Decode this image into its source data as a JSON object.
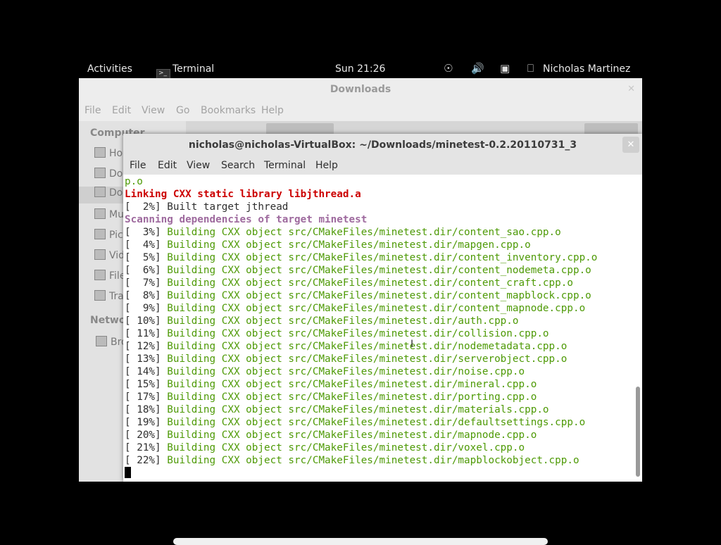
{
  "top_panel": {
    "activities": "Activities",
    "app_name": "Terminal",
    "clock": "Sun 21:26",
    "user": "Nicholas Martinez"
  },
  "file_manager": {
    "title": "Downloads",
    "menu": [
      "File",
      "Edit",
      "View",
      "Go",
      "Bookmarks",
      "Help"
    ],
    "sidebar_headers": [
      "Computer",
      "Netwo"
    ],
    "sidebar_items": [
      "Ho",
      "Do",
      "Do",
      "Mu",
      "Pic",
      "Vid",
      "File",
      "Tra",
      "Bro"
    ]
  },
  "terminal": {
    "title": "nicholas@nicholas-VirtualBox: ~/Downloads/minetest-0.2.20110731_3",
    "menu": [
      "File",
      "Edit",
      "View",
      "Search",
      "Terminal",
      "Help"
    ],
    "lines": [
      {
        "prefix": "",
        "text": "p.o",
        "style": "g"
      },
      {
        "prefix": "",
        "text": "Linking CXX static library libjthread.a",
        "style": "r"
      },
      {
        "prefix": "[  2%] ",
        "text": "Built target jthread",
        "style": ""
      },
      {
        "prefix": "",
        "text": "Scanning dependencies of target minetest",
        "style": "m"
      },
      {
        "prefix": "[  3%] ",
        "text": "Building CXX object src/CMakeFiles/minetest.dir/content_sao.cpp.o",
        "style": "g"
      },
      {
        "prefix": "[  4%] ",
        "text": "Building CXX object src/CMakeFiles/minetest.dir/mapgen.cpp.o",
        "style": "g"
      },
      {
        "prefix": "[  5%] ",
        "text": "Building CXX object src/CMakeFiles/minetest.dir/content_inventory.cpp.o",
        "style": "g"
      },
      {
        "prefix": "[  6%] ",
        "text": "Building CXX object src/CMakeFiles/minetest.dir/content_nodemeta.cpp.o",
        "style": "g"
      },
      {
        "prefix": "[  7%] ",
        "text": "Building CXX object src/CMakeFiles/minetest.dir/content_craft.cpp.o",
        "style": "g"
      },
      {
        "prefix": "[  8%] ",
        "text": "Building CXX object src/CMakeFiles/minetest.dir/content_mapblock.cpp.o",
        "style": "g"
      },
      {
        "prefix": "[  9%] ",
        "text": "Building CXX object src/CMakeFiles/minetest.dir/content_mapnode.cpp.o",
        "style": "g"
      },
      {
        "prefix": "[ 10%] ",
        "text": "Building CXX object src/CMakeFiles/minetest.dir/auth.cpp.o",
        "style": "g"
      },
      {
        "prefix": "[ 11%] ",
        "text": "Building CXX object src/CMakeFiles/minetest.dir/collision.cpp.o",
        "style": "g"
      },
      {
        "prefix": "[ 12%] ",
        "text": "Building CXX object src/CMakeFiles/minetest.dir/nodemetadata.cpp.o",
        "style": "g"
      },
      {
        "prefix": "[ 13%] ",
        "text": "Building CXX object src/CMakeFiles/minetest.dir/serverobject.cpp.o",
        "style": "g"
      },
      {
        "prefix": "[ 14%] ",
        "text": "Building CXX object src/CMakeFiles/minetest.dir/noise.cpp.o",
        "style": "g"
      },
      {
        "prefix": "[ 15%] ",
        "text": "Building CXX object src/CMakeFiles/minetest.dir/mineral.cpp.o",
        "style": "g"
      },
      {
        "prefix": "[ 17%] ",
        "text": "Building CXX object src/CMakeFiles/minetest.dir/porting.cpp.o",
        "style": "g"
      },
      {
        "prefix": "[ 18%] ",
        "text": "Building CXX object src/CMakeFiles/minetest.dir/materials.cpp.o",
        "style": "g"
      },
      {
        "prefix": "[ 19%] ",
        "text": "Building CXX object src/CMakeFiles/minetest.dir/defaultsettings.cpp.o",
        "style": "g"
      },
      {
        "prefix": "[ 20%] ",
        "text": "Building CXX object src/CMakeFiles/minetest.dir/mapnode.cpp.o",
        "style": "g"
      },
      {
        "prefix": "[ 21%] ",
        "text": "Building CXX object src/CMakeFiles/minetest.dir/voxel.cpp.o",
        "style": "g"
      },
      {
        "prefix": "[ 22%] ",
        "text": "Building CXX object src/CMakeFiles/minetest.dir/mapblockobject.cpp.o",
        "style": "g"
      }
    ]
  },
  "colors": {
    "build_green": "#4e9a06",
    "link_red": "#cc0000",
    "scan_magenta": "#9e6a9e"
  },
  "icons": [
    "accessibility-icon",
    "volume-icon",
    "network-icon",
    "user-icon",
    "terminal-app-icon",
    "close-icon"
  ]
}
